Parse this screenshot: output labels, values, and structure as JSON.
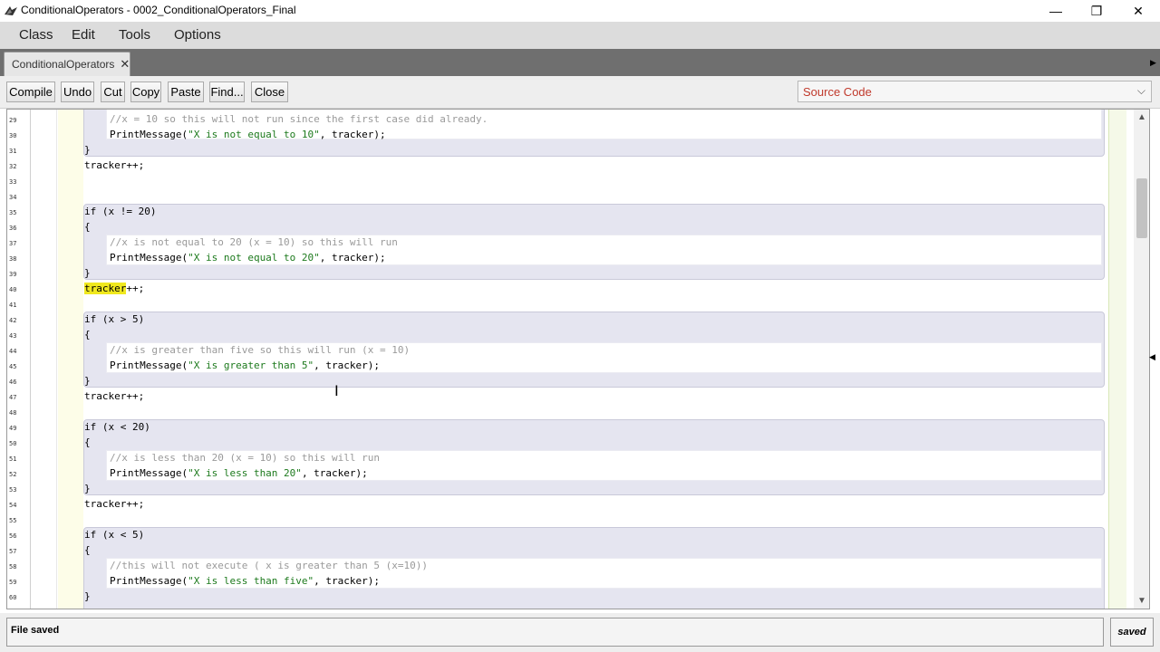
{
  "window": {
    "title": "ConditionalOperators - 0002_ConditionalOperators_Final",
    "minimize_glyph": "—",
    "maximize_glyph": "❐",
    "close_glyph": "✕"
  },
  "menu": {
    "items": [
      "Class",
      "Edit",
      "Tools",
      "Options"
    ]
  },
  "tabs": [
    {
      "label": "ConditionalOperators",
      "close_glyph": "✕"
    }
  ],
  "toolbar": {
    "buttons": [
      "Compile",
      "Undo",
      "Cut",
      "Copy",
      "Paste",
      "Find...",
      "Close"
    ],
    "view_select": {
      "value": "Source Code"
    }
  },
  "editor": {
    "line_numbers": [
      "29",
      "30",
      "31",
      "32",
      "33",
      "34",
      "35",
      "36",
      "37",
      "38",
      "39",
      "40",
      "41",
      "42",
      "43",
      "44",
      "45",
      "46",
      "47",
      "48",
      "49",
      "50",
      "51",
      "52",
      "53",
      "54",
      "55",
      "56",
      "57",
      "58",
      "59",
      "60"
    ],
    "lines": {
      "l29": "//x = 10 so this will not run since the first case did already.",
      "l30_a": "PrintMessage(",
      "l30_s": "\"X is not equal to 10\"",
      "l30_b": ", tracker);",
      "l31": "}",
      "l32": "tracker++;",
      "l35": "if (x != 20)",
      "l36": "{",
      "l37": "//x is not equal to 20 (x = 10) so this will run",
      "l38_a": "PrintMessage(",
      "l38_s": "\"X is not equal to 20\"",
      "l38_b": ", tracker);",
      "l39": "}",
      "l40_hl": "tracker",
      "l40_rest": "++;",
      "l42": "if (x > 5)",
      "l43": "{",
      "l44": "//x is greater than five so this will run (x = 10)",
      "l45_a": "PrintMessage(",
      "l45_s": "\"X is greater than 5\"",
      "l45_b": ", tracker);",
      "l46": "}",
      "l47": "tracker++;",
      "l49": "if (x < 20)",
      "l50": "{",
      "l51": "//x is less than 20 (x = 10) so this will run",
      "l52_a": "PrintMessage(",
      "l52_s": "\"X is less than 20\"",
      "l52_b": ", tracker);",
      "l53": "}",
      "l54": "tracker++;",
      "l56": "if (x < 5)",
      "l57": "{",
      "l58": "//this will not execute ( x is greater than 5 (x=10))",
      "l59_a": "PrintMessage(",
      "l59_s": "\"X is less than five\"",
      "l59_b": ", tracker);",
      "l60": "}"
    }
  },
  "status": {
    "message": "File saved",
    "state": "saved"
  },
  "colors": {
    "block_bg": "#e5e5f0",
    "string": "#1d7a1d",
    "comment": "#9a9a9a",
    "highlight": "#f0e81e",
    "select_text": "#c0392b"
  }
}
